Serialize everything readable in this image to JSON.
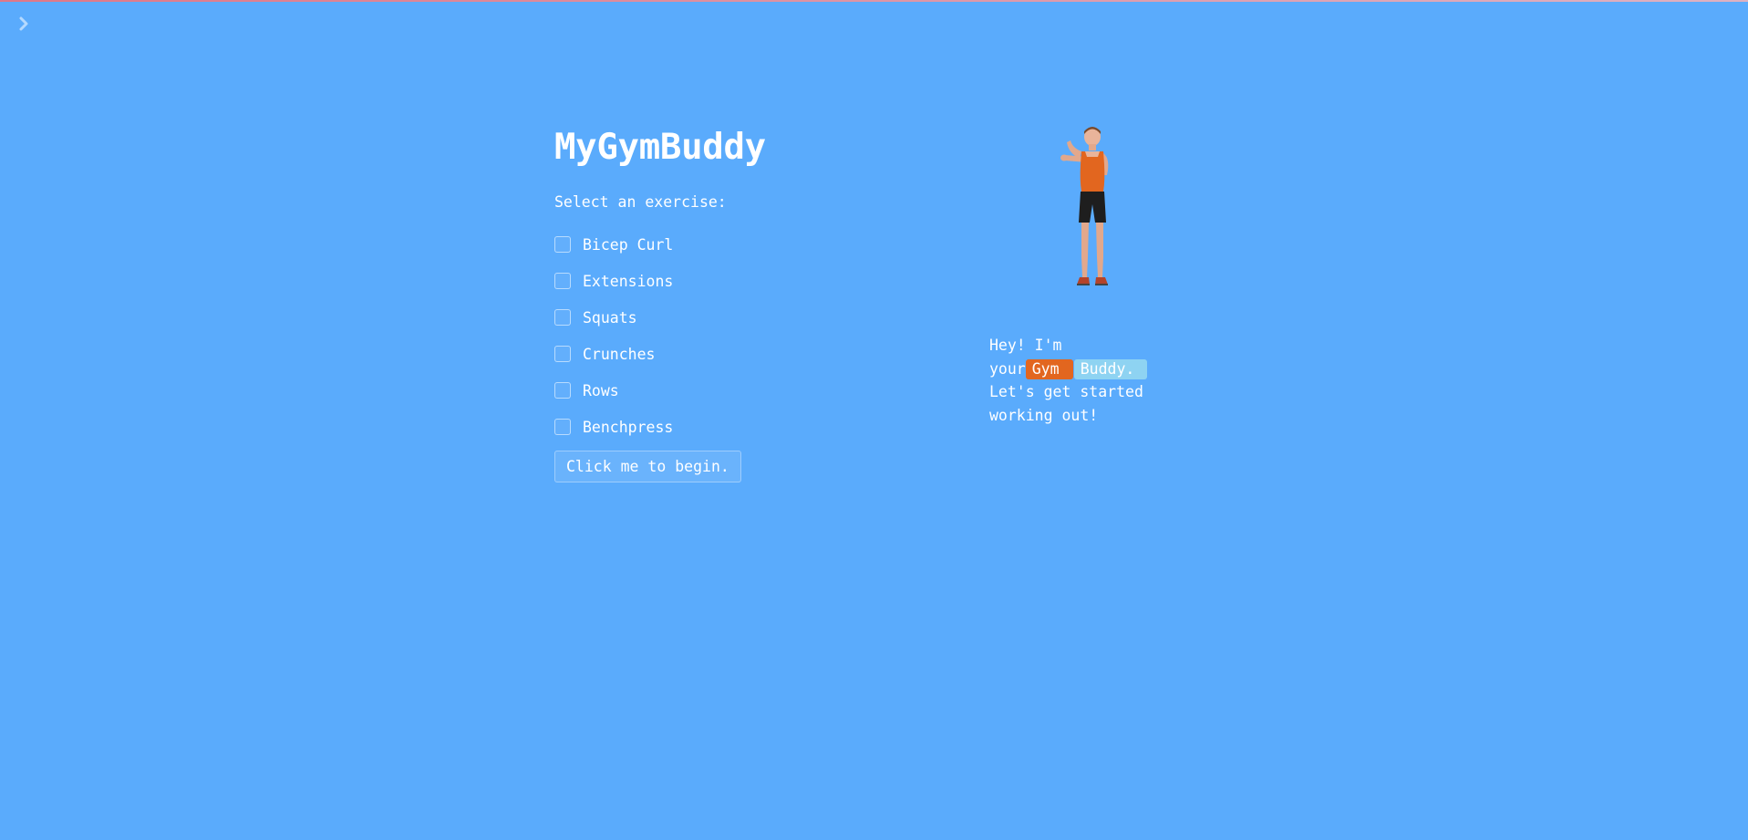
{
  "sidebar": {
    "toggle_icon": "chevron-right-icon"
  },
  "main": {
    "title": "MyGymBuddy",
    "prompt": "Select an exercise:",
    "exercises": [
      {
        "label": "Bicep Curl",
        "checked": false
      },
      {
        "label": "Extensions",
        "checked": false
      },
      {
        "label": "Squats",
        "checked": false
      },
      {
        "label": "Crunches",
        "checked": false
      },
      {
        "label": "Rows",
        "checked": false
      },
      {
        "label": "Benchpress",
        "checked": false
      }
    ],
    "begin_label": "Click me to begin."
  },
  "buddy": {
    "image": "stretching-athlete-illustration",
    "line1": "Hey! I'm",
    "your": "your",
    "gym": "Gym",
    "buddy": "Buddy.",
    "line3": "Let's get started",
    "line4": "working out!"
  },
  "colors": {
    "background": "#5aabfc",
    "gym_chip": "#e2661f",
    "buddy_chip": "#8ed3f2"
  }
}
